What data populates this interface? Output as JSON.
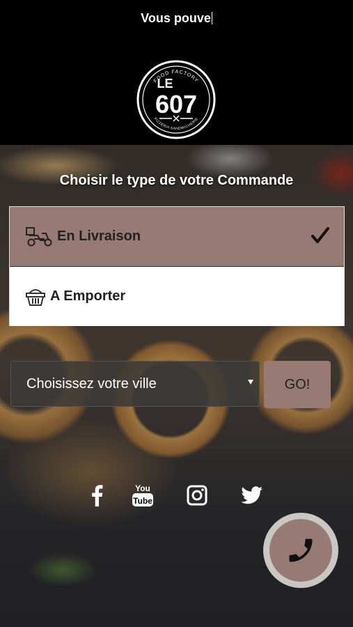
{
  "header": {
    "marquee_text": "Vous pouve",
    "logo": {
      "top_text": "FOOD FACTORY",
      "main_line1": "LE",
      "main_line2": "607",
      "bottom_text": "PIZZERIA SANDWICHERIE"
    }
  },
  "order": {
    "title": "Choisir le type de votre Commande",
    "options": [
      {
        "label": "En Livraison",
        "icon": "delivery-scooter-icon",
        "selected": true
      },
      {
        "label": "A Emporter",
        "icon": "basket-icon",
        "selected": false
      }
    ]
  },
  "city": {
    "placeholder": "Choisissez votre ville",
    "go_label": "GO!"
  },
  "social": [
    "facebook-icon",
    "youtube-icon",
    "instagram-icon",
    "twitter-icon"
  ],
  "colors": {
    "accent": "#967a73",
    "header_bg": "#000000",
    "option_bg": "#ffffff"
  }
}
